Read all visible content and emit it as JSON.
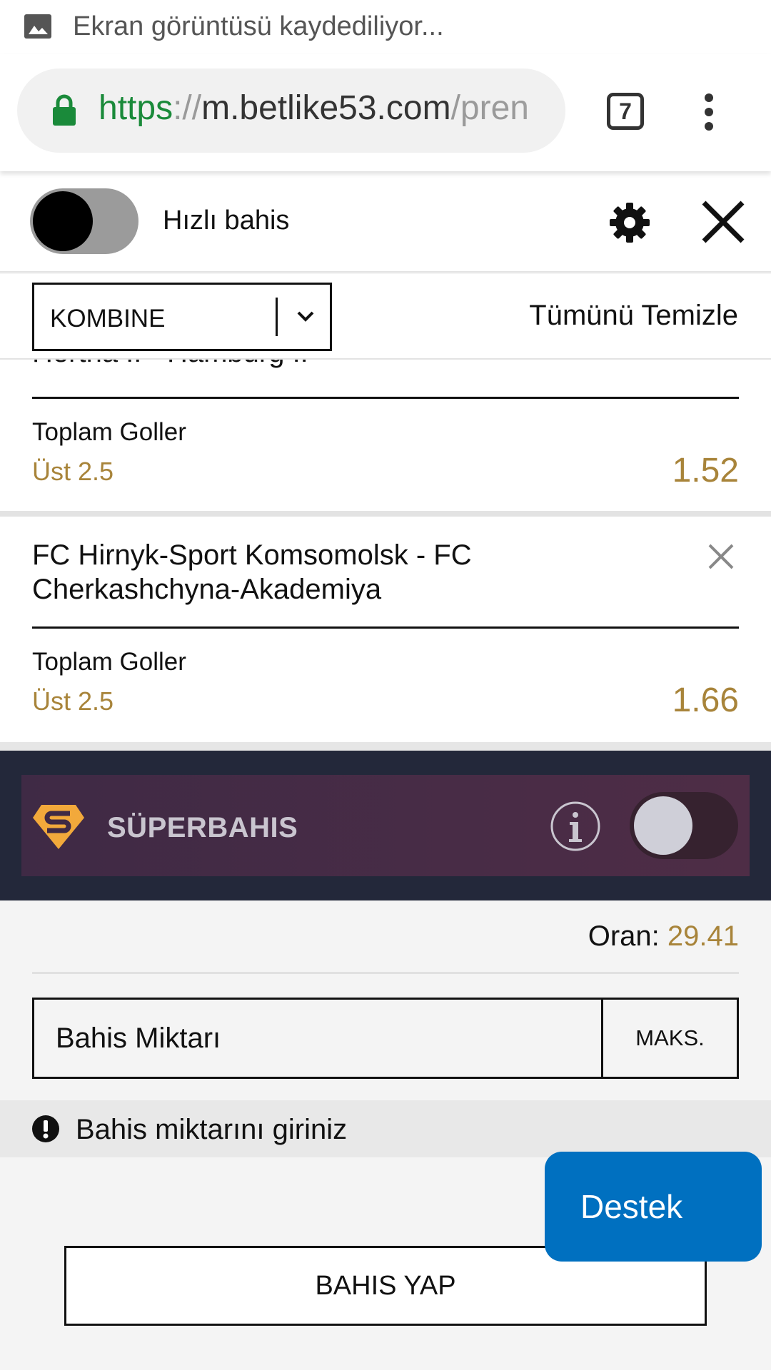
{
  "status_bar": {
    "text": "Ekran görüntüsü kaydediliyor..."
  },
  "browser": {
    "url_scheme": "https",
    "url_sep": "://",
    "url_host": "m.betlike53.com",
    "url_path": "/pren",
    "tab_count": "7"
  },
  "top_bar": {
    "quick_bet_label": "Hızlı bahis"
  },
  "slip_header": {
    "bet_type": "KOMBINE",
    "clear_all": "Tümünü Temizle"
  },
  "bets": [
    {
      "match": "Hertha II - Hamburg II",
      "market": "Toplam Goller",
      "selection": "Üst 2.5",
      "odds": "1.52"
    },
    {
      "match": "FC Hirnyk-Sport Komsomolsk - FC Cherkashchyna-Akademiya",
      "market": "Toplam Goller",
      "selection": "Üst 2.5",
      "odds": "1.66"
    }
  ],
  "superbet": {
    "label": "SÜPERBAHIS"
  },
  "summary": {
    "odds_label": "Oran:",
    "odds_total": "29.41",
    "stake_placeholder": "Bahis Miktarı",
    "max_label": "MAKS.",
    "warning": "Bahis miktarını giriniz",
    "place_bet": "BAHIS YAP"
  },
  "support": {
    "label": "Destek"
  },
  "colors": {
    "accent_gold": "#a8843a",
    "support_blue": "#0070c0",
    "superbet_band": "#23283a",
    "url_green": "#1a8a3a"
  },
  "icons": [
    "image-icon",
    "lock-icon",
    "tab-counter",
    "menu-icon",
    "gear-icon",
    "close-icon",
    "chevron-down-icon",
    "remove-icon",
    "superbet-logo-icon",
    "info-icon",
    "warning-icon"
  ]
}
